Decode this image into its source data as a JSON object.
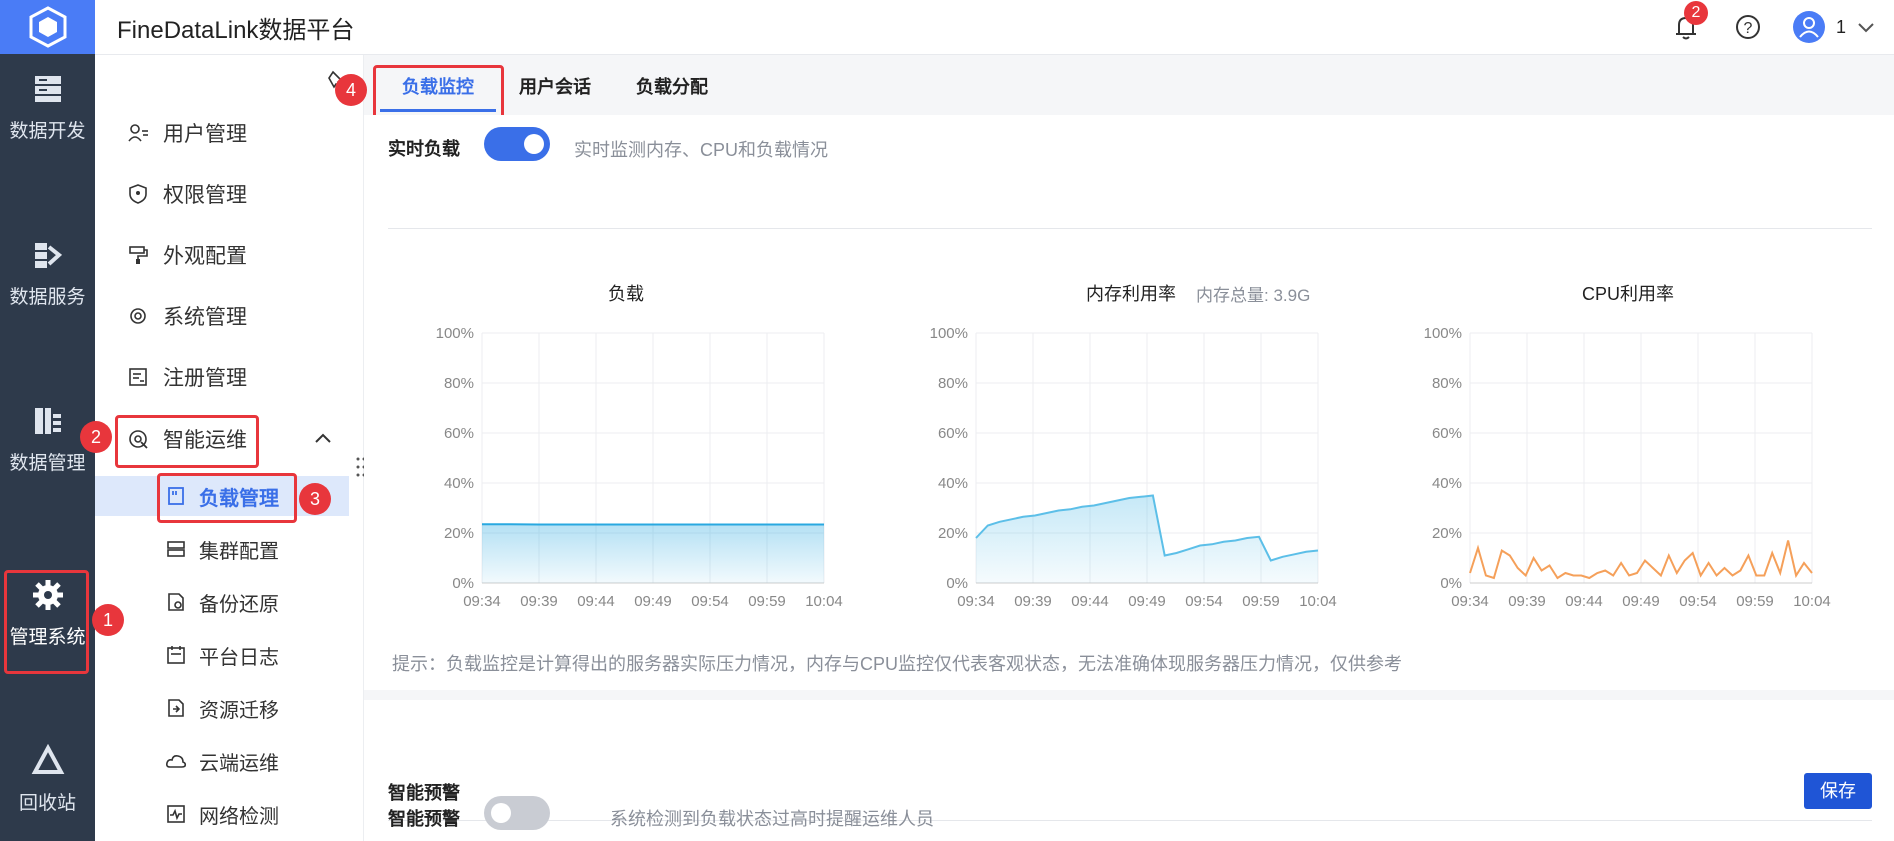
{
  "app": {
    "title": "FineDataLink数据平台"
  },
  "topbar": {
    "notification_count": "2",
    "user_label": "1"
  },
  "rail": {
    "items": [
      {
        "label": "数据开发",
        "icon": "server-icon"
      },
      {
        "label": "数据服务",
        "icon": "data-service-icon"
      },
      {
        "label": "数据管理",
        "icon": "data-manage-icon"
      },
      {
        "label": "管理系统",
        "icon": "gear-icon"
      },
      {
        "label": "回收站",
        "icon": "recycle-icon"
      }
    ]
  },
  "sidebar": {
    "items": [
      {
        "label": "用户管理",
        "icon": "user-manage-icon"
      },
      {
        "label": "权限管理",
        "icon": "permission-icon"
      },
      {
        "label": "外观配置",
        "icon": "paint-icon"
      },
      {
        "label": "系统管理",
        "icon": "gear-icon"
      },
      {
        "label": "注册管理",
        "icon": "register-icon"
      },
      {
        "label": "智能运维",
        "icon": "ops-icon"
      }
    ],
    "sub_items": [
      {
        "label": "负载管理",
        "icon": "load-icon"
      },
      {
        "label": "集群配置",
        "icon": "cluster-icon"
      },
      {
        "label": "备份还原",
        "icon": "backup-icon"
      },
      {
        "label": "平台日志",
        "icon": "log-icon"
      },
      {
        "label": "资源迁移",
        "icon": "migrate-icon"
      },
      {
        "label": "云端运维",
        "icon": "cloud-icon"
      },
      {
        "label": "网络检测",
        "icon": "network-icon"
      }
    ]
  },
  "tabs": [
    {
      "label": "负载监控"
    },
    {
      "label": "用户会话"
    },
    {
      "label": "负载分配"
    }
  ],
  "realtime": {
    "label": "实时负载",
    "description": "实时监测内存、CPU和负载情况",
    "enabled": true
  },
  "memory_total": "内存总量: 3.9G",
  "hint": "提示：负载监控是计算得出的服务器实际压力情况，内存与CPU监控仅代表客观状态，无法准确体现服务器压力情况，仅供参考",
  "warning": {
    "section_title": "智能预警",
    "save_label": "保存",
    "toggle_label": "智能预警",
    "description": "系统检测到负载状态过高时提醒运维人员",
    "enabled": false
  },
  "callouts": [
    "1",
    "2",
    "3",
    "4"
  ],
  "colors": {
    "accent": "#3a6fe8",
    "rail_bg": "#2e3a4b",
    "callout": "#e8363c",
    "load_line": "#29a8e0",
    "memory_line": "#5cbfe8",
    "cpu_line": "#f5a05a"
  },
  "chart_data": [
    {
      "type": "area",
      "title": "负载",
      "x": [
        "09:34",
        "09:39",
        "09:44",
        "09:49",
        "09:54",
        "09:59",
        "10:04"
      ],
      "ylim": [
        0,
        100
      ],
      "yticks": [
        "0%",
        "20%",
        "40%",
        "60%",
        "80%",
        "100%"
      ],
      "series": [
        {
          "values": [
            23.5,
            23.5,
            23.4,
            23.4,
            23.4,
            23.4,
            23.4,
            23.4,
            23.4,
            23.4,
            23.4,
            23.4,
            23.4
          ]
        }
      ]
    },
    {
      "type": "area",
      "title": "内存利用率",
      "x": [
        "09:34",
        "09:39",
        "09:44",
        "09:49",
        "09:54",
        "09:59",
        "10:04"
      ],
      "ylim": [
        0,
        100
      ],
      "yticks": [
        "0%",
        "20%",
        "40%",
        "60%",
        "80%",
        "100%"
      ],
      "series": [
        {
          "values": [
            18,
            23,
            24.5,
            25.5,
            26.5,
            27,
            28,
            29,
            29.5,
            30.5,
            31,
            32,
            33,
            34,
            34.5,
            35,
            11,
            12,
            13.5,
            15,
            15.5,
            16.5,
            17,
            18,
            18.5,
            9,
            10.5,
            11.5,
            12.5,
            13
          ]
        }
      ]
    },
    {
      "type": "line",
      "title": "CPU利用率",
      "x": [
        "09:34",
        "09:39",
        "09:44",
        "09:49",
        "09:54",
        "09:59",
        "10:04"
      ],
      "ylim": [
        0,
        100
      ],
      "yticks": [
        "0%",
        "20%",
        "40%",
        "60%",
        "80%",
        "100%"
      ],
      "series": [
        {
          "values": [
            4,
            14,
            3,
            2,
            13,
            11,
            6,
            3,
            10,
            5,
            7,
            2,
            4,
            3,
            3,
            2,
            4,
            5,
            3,
            8,
            3,
            4,
            9,
            6,
            3,
            11,
            4,
            9,
            12,
            3,
            8,
            3,
            6,
            3,
            5,
            11,
            3,
            3,
            12,
            4,
            17,
            3,
            8,
            4
          ]
        }
      ]
    }
  ]
}
